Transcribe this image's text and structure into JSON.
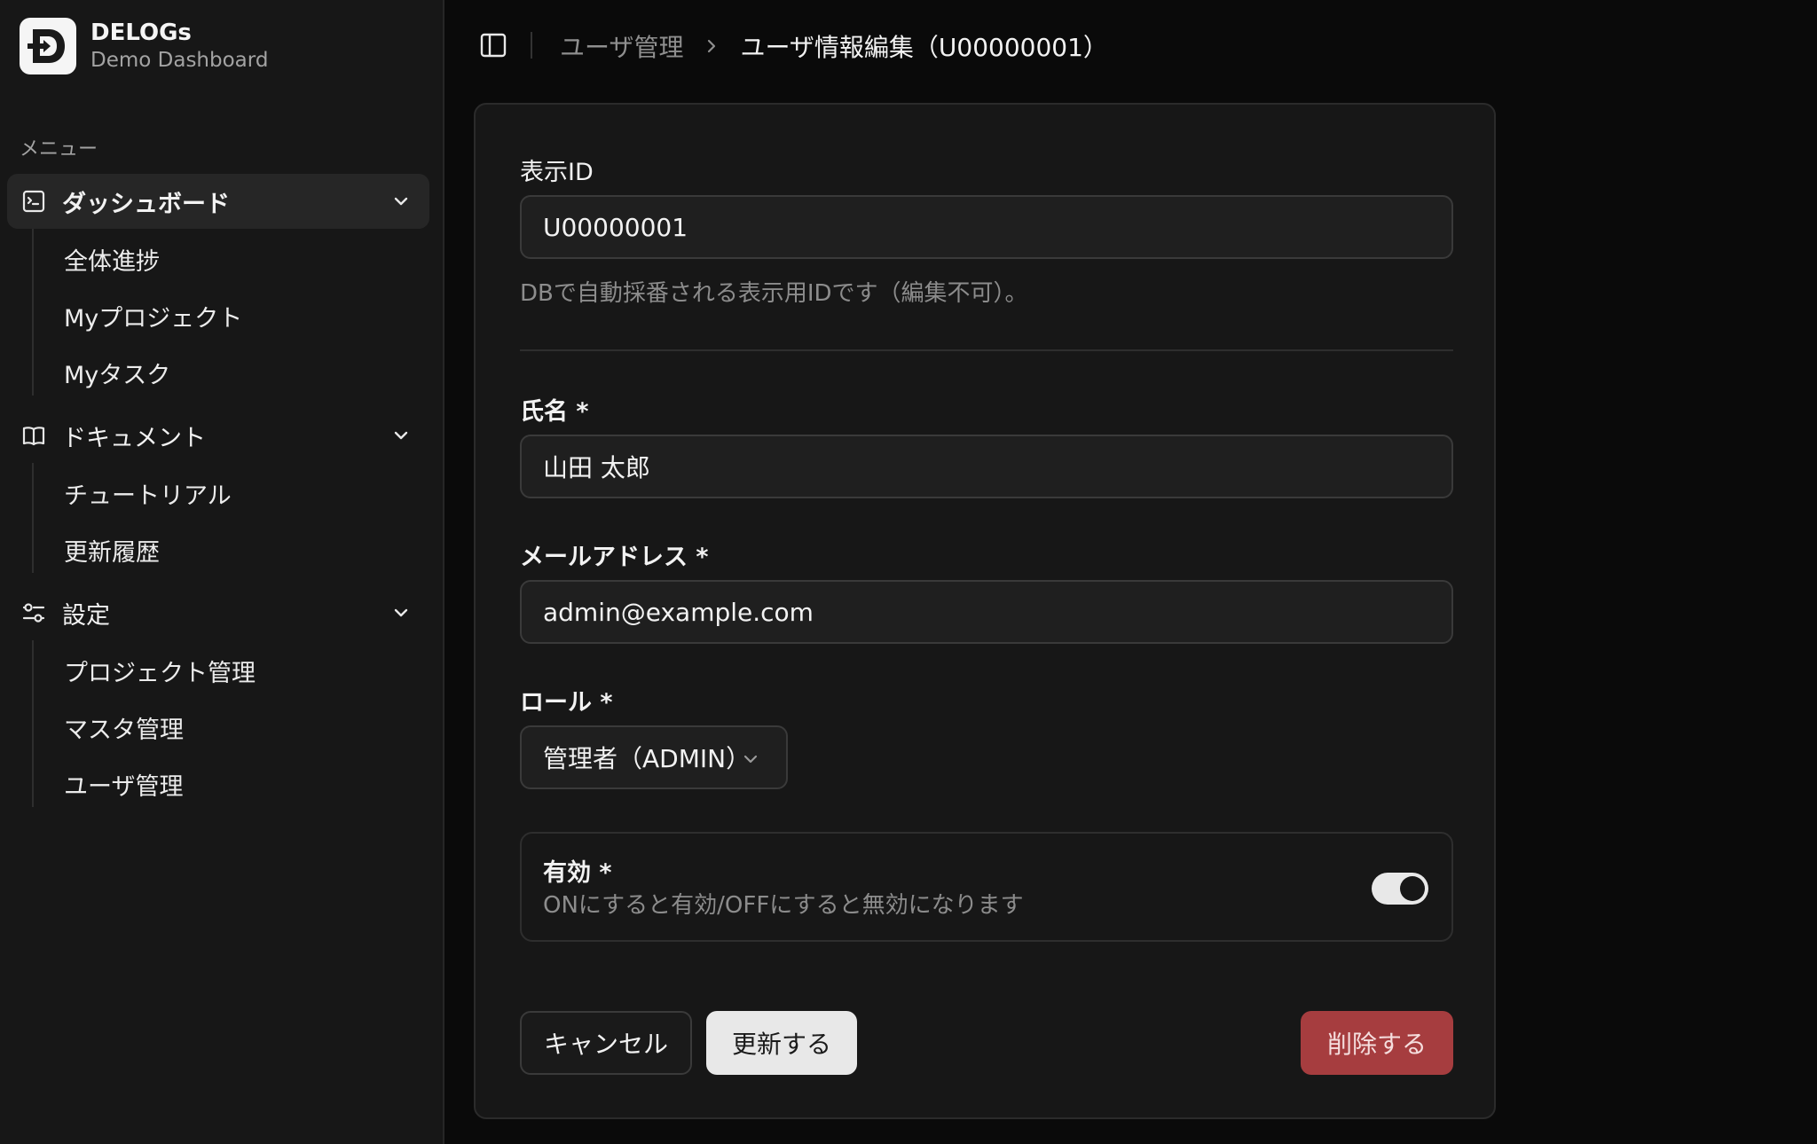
{
  "brand": {
    "name": "DELOGs",
    "subtitle": "Demo Dashboard",
    "logo_icon": "delogs-logo-icon"
  },
  "sidebar": {
    "menu_label": "メニュー",
    "groups": [
      {
        "label": "ダッシュボード",
        "icon": "dashboard-icon",
        "active": true,
        "items": [
          {
            "label": "全体進捗"
          },
          {
            "label": "Myプロジェクト"
          },
          {
            "label": "Myタスク"
          }
        ]
      },
      {
        "label": "ドキュメント",
        "icon": "book-icon",
        "active": false,
        "items": [
          {
            "label": "チュートリアル"
          },
          {
            "label": "更新履歴"
          }
        ]
      },
      {
        "label": "設定",
        "icon": "settings-sliders-icon",
        "active": false,
        "items": [
          {
            "label": "プロジェクト管理"
          },
          {
            "label": "マスタ管理"
          },
          {
            "label": "ユーザ管理"
          }
        ]
      }
    ]
  },
  "header": {
    "breadcrumb": {
      "parent": "ユーザ管理",
      "current": "ユーザ情報編集（U00000001）"
    }
  },
  "form": {
    "display_id": {
      "label": "表示ID",
      "value": "U00000001",
      "help": "DBで自動採番される表示用IDです（編集不可）。"
    },
    "name": {
      "label": "氏名 *",
      "value": "山田 太郎"
    },
    "email": {
      "label": "メールアドレス *",
      "value": "admin@example.com"
    },
    "role": {
      "label": "ロール *",
      "value": "管理者（ADMIN）"
    },
    "active": {
      "label": "有効 *",
      "description": "ONにすると有効/OFFにすると無効になります",
      "on": true
    },
    "buttons": {
      "cancel": "キャンセル",
      "update": "更新する",
      "delete": "削除する"
    }
  },
  "colors": {
    "background": "#0a0a0a",
    "sidebar": "#171717",
    "card": "#171717",
    "danger": "#a63d3f",
    "primary_button": "#e8e8e8"
  }
}
